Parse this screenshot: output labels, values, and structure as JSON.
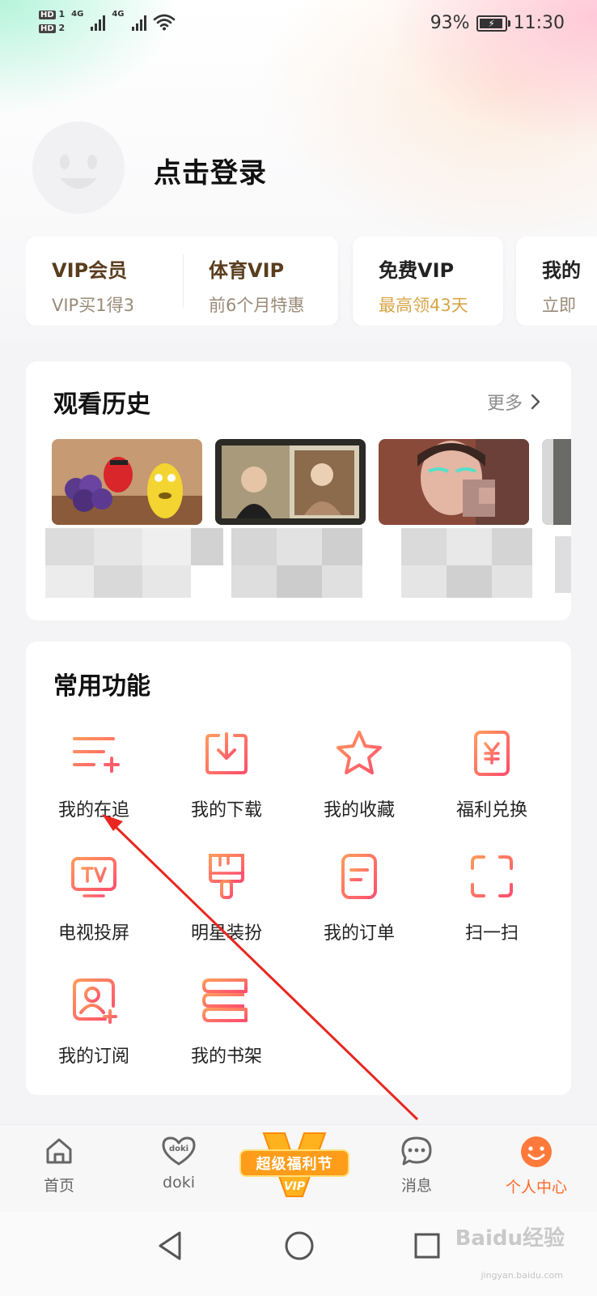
{
  "status_bar": {
    "hd1": "HD",
    "hd1_num": "1",
    "hd2": "HD",
    "hd2_num": "2",
    "net1": "4G",
    "net2": "4G",
    "battery": "93%",
    "battery_level": 0.93,
    "time": "11:30"
  },
  "profile": {
    "login_label": "点击登录"
  },
  "vip_cards": [
    {
      "title": "VIP会员",
      "subtitle": "VIP买1得3"
    },
    {
      "title": "体育VIP",
      "subtitle": "前6个月特惠"
    },
    {
      "title": "免费VIP",
      "subtitle": "最高领43天"
    },
    {
      "title": "我的",
      "subtitle": "立即"
    }
  ],
  "history": {
    "title": "观看历史",
    "more_label": "更多"
  },
  "functions": {
    "title": "常用功能",
    "items": [
      {
        "label": "我的在追",
        "icon": "follow-list-icon"
      },
      {
        "label": "我的下载",
        "icon": "download-icon"
      },
      {
        "label": "我的收藏",
        "icon": "star-icon"
      },
      {
        "label": "福利兑换",
        "icon": "coupon-yen-icon"
      },
      {
        "label": "电视投屏",
        "icon": "tv-cast-icon"
      },
      {
        "label": "明星装扮",
        "icon": "paint-brush-icon"
      },
      {
        "label": "我的订单",
        "icon": "order-icon"
      },
      {
        "label": "扫一扫",
        "icon": "scan-icon"
      },
      {
        "label": "我的订阅",
        "icon": "subscription-icon"
      },
      {
        "label": "我的书架",
        "icon": "bookshelf-icon"
      }
    ]
  },
  "bottom_nav": {
    "home": "首页",
    "doki": "doki",
    "promo": "超级福利节",
    "promo_vip": "VIP",
    "messages": "消息",
    "profile": "个人中心",
    "doki_badge": "doki"
  },
  "watermark": {
    "text": "Baidu经验",
    "sub": "jingyan.baidu.com"
  },
  "colors": {
    "accent": "#ff6a2a",
    "icon_gradient_start": "#ff8a5c",
    "icon_gradient_end": "#ff4f6e",
    "vip_title": "#5a3d1e",
    "free_vip_sub": "#d7a548",
    "annotation_arrow": "#e8261f"
  }
}
